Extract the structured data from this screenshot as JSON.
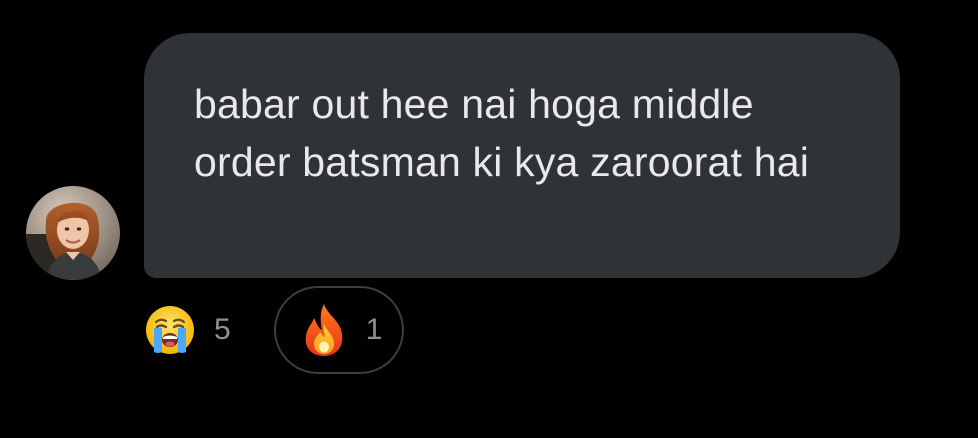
{
  "message": {
    "text": "babar out hee nai hoga middle order batsman ki kya zaroorat hai"
  },
  "reactions": [
    {
      "icon": "loudly-crying-face-icon",
      "count": "5",
      "selected": false
    },
    {
      "icon": "fire-icon",
      "count": "1",
      "selected": true
    }
  ],
  "colors": {
    "background": "#000000",
    "bubble": "#2f3336",
    "text": "#e7e9ea",
    "count": "#8b9298",
    "pill_border": "#3a3e42"
  }
}
